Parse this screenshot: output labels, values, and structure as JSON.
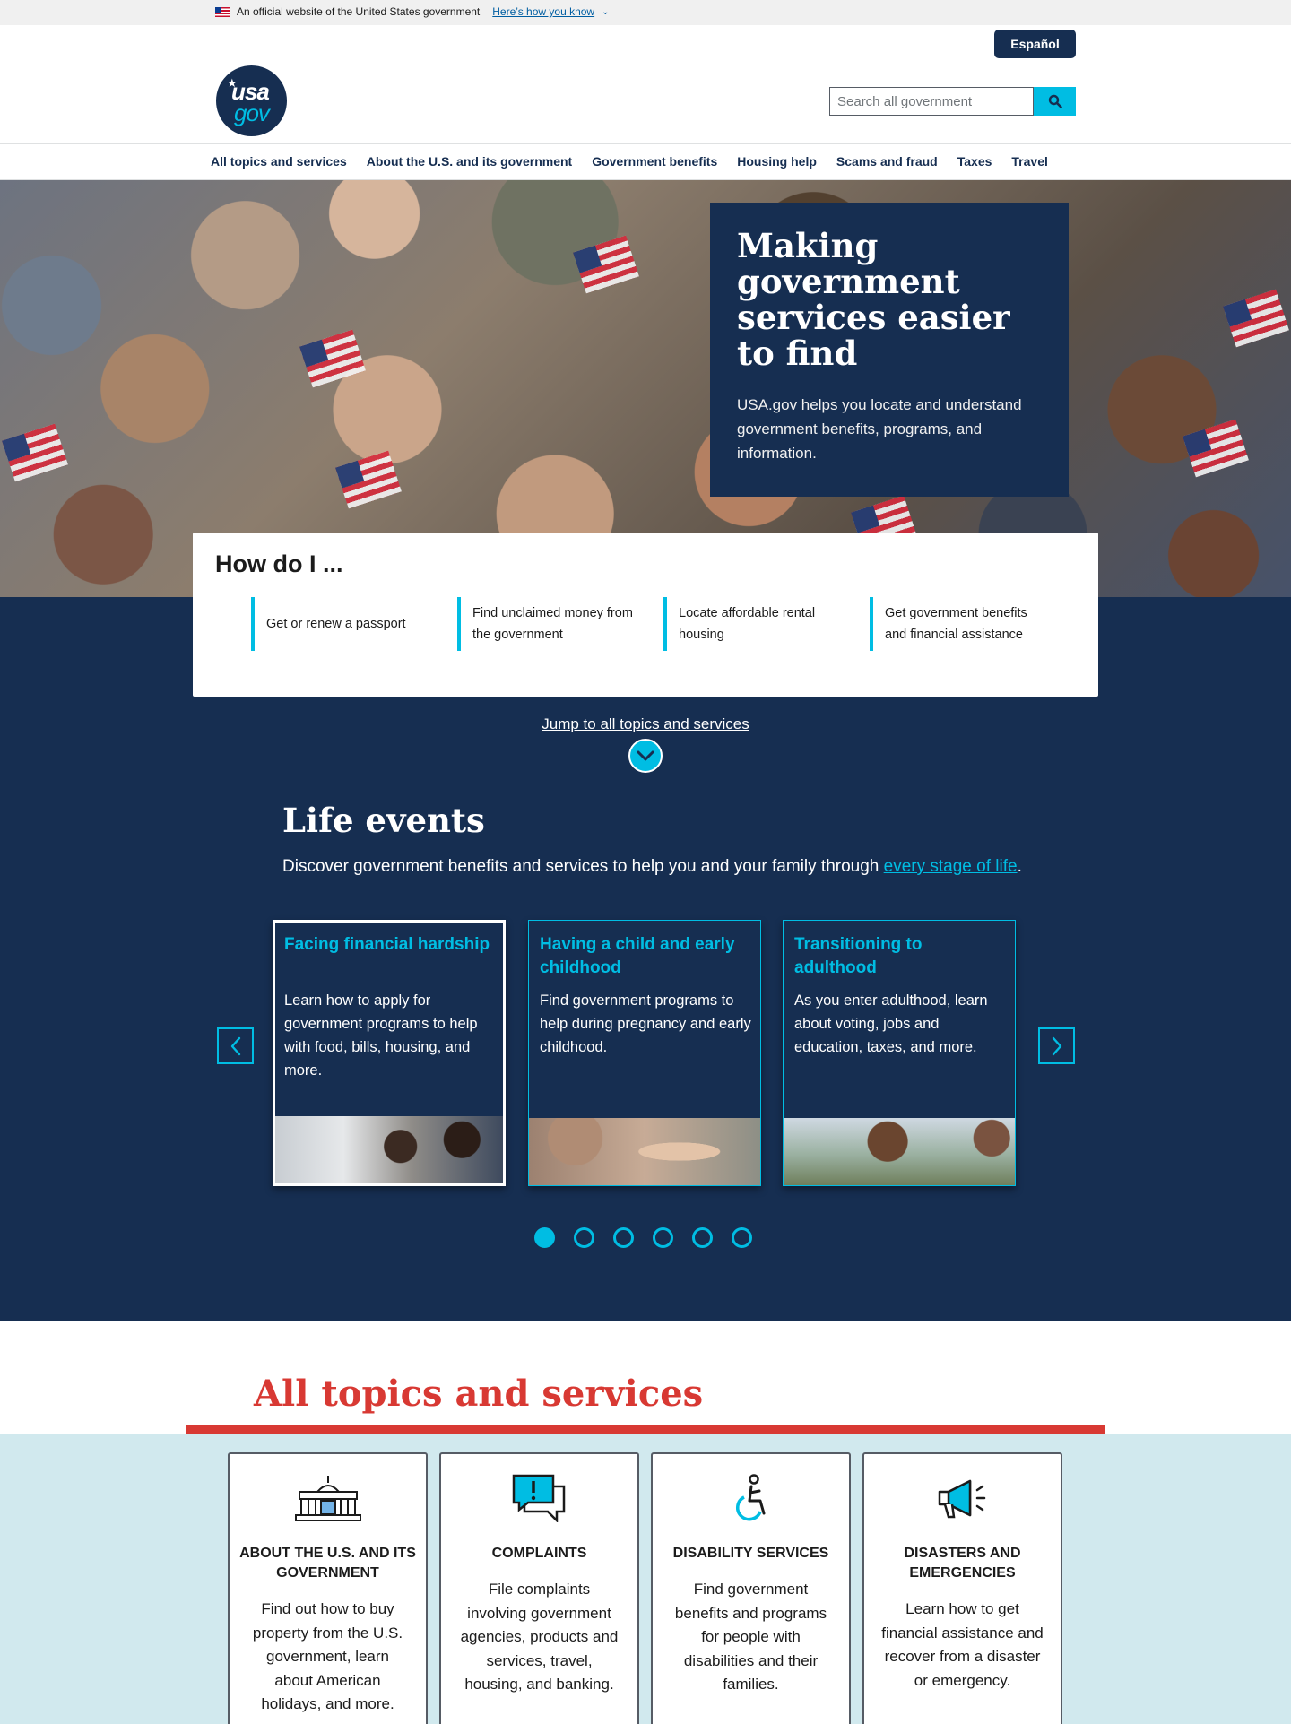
{
  "gov_banner": {
    "text": "An official website of the United States government",
    "link": "Here’s how you know"
  },
  "header": {
    "language_button": "Español",
    "logo_top": "usa",
    "logo_bottom": "gov",
    "search_placeholder": "Search all government"
  },
  "nav": {
    "items": [
      "All topics and services",
      "About the U.S. and its government",
      "Government benefits",
      "Housing help",
      "Scams and fraud",
      "Taxes",
      "Travel"
    ]
  },
  "hero": {
    "title": "Making government services easier to find",
    "description": "USA.gov helps you locate and understand government benefits, programs, and information."
  },
  "how_do_i": {
    "title": "How do I ...",
    "links": [
      "Get or renew a passport",
      "Find unclaimed money from the government",
      "Locate affordable rental housing",
      "Get government benefits and financial assistance"
    ]
  },
  "jump_link": "Jump to all topics and services",
  "life_events": {
    "title": "Life events",
    "description_prefix": "Discover government benefits and services to help you and your family through ",
    "description_link": "every stage of life",
    "description_suffix": ".",
    "cards": [
      {
        "title": "Facing financial hardship",
        "text": "Learn how to apply for government programs to help with food, bills, housing, and more."
      },
      {
        "title": "Having a child and early childhood",
        "text": "Find government programs to help during pregnancy and early childhood."
      },
      {
        "title": "Transitioning to adulthood",
        "text": "As you enter adulthood, learn about voting, jobs and education, taxes, and more."
      }
    ],
    "active_dot": 1,
    "dot_count": 6
  },
  "topics": {
    "title": "All topics and services",
    "cards": [
      {
        "icon": "capitol-building-icon",
        "title": "ABOUT THE U.S. AND ITS GOVERNMENT",
        "text": "Find out how to buy property from the U.S. government, learn about American holidays, and more."
      },
      {
        "icon": "complaint-speech-icon",
        "title": "COMPLAINTS",
        "text": "File complaints involving government agencies, products and services, travel, housing, and banking."
      },
      {
        "icon": "accessibility-icon",
        "title": "DISABILITY SERVICES",
        "text": "Find government benefits and programs for people with disabilities and their families."
      },
      {
        "icon": "megaphone-icon",
        "title": "DISASTERS AND EMERGENCIES",
        "text": "Learn how to get financial assistance and recover from a disaster or emergency."
      }
    ]
  },
  "colors": {
    "navy": "#162e51",
    "cyan": "#00bde3",
    "red": "#d83933",
    "light_blue": "#d1e9ee"
  }
}
